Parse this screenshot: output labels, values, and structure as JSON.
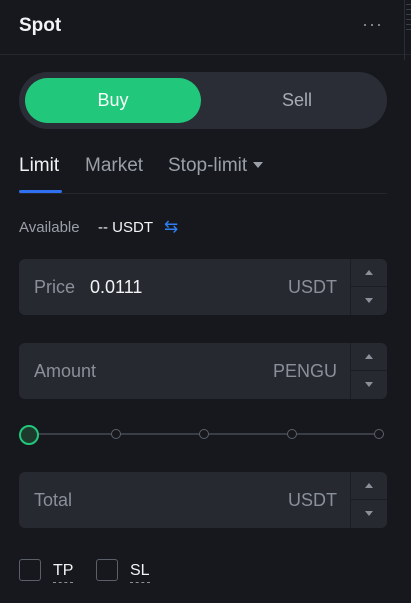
{
  "header": {
    "title": "Spot",
    "more_icon": "more-horizontal-icon"
  },
  "side": {
    "buy_label": "Buy",
    "sell_label": "Sell",
    "buy_color": "#21c77a"
  },
  "order_tabs": [
    {
      "label": "Limit",
      "active": true
    },
    {
      "label": "Market",
      "active": false
    },
    {
      "label": "Stop-limit",
      "active": false
    }
  ],
  "available": {
    "label": "Available",
    "value": "-- USDT",
    "transfer_icon": "transfer-arrows-icon"
  },
  "price_field": {
    "label": "Price",
    "value": "0.0111",
    "unit": "USDT"
  },
  "amount_field": {
    "label": "Amount",
    "unit": "PENGU"
  },
  "total_field": {
    "label": "Total",
    "unit": "USDT"
  },
  "slider": {
    "value_percent": 0
  },
  "options": {
    "tp_label": "TP",
    "sl_label": "SL"
  }
}
